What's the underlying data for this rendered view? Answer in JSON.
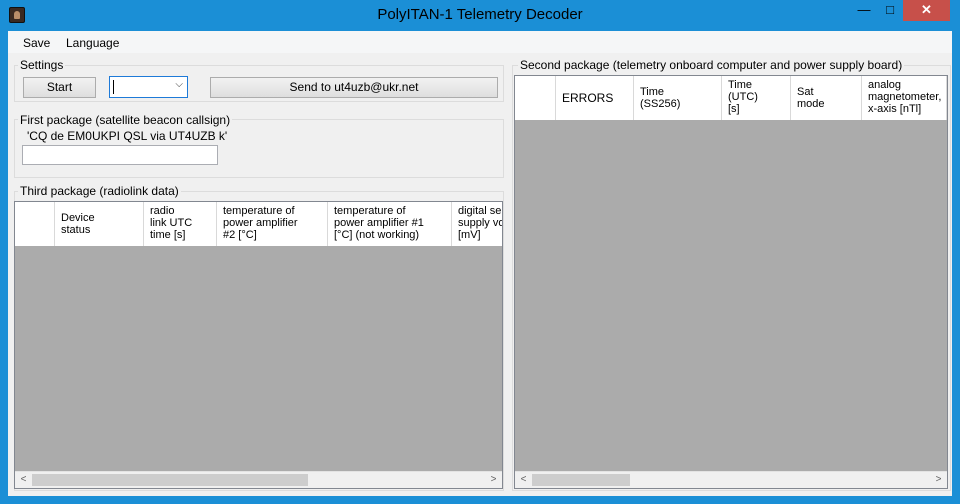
{
  "window": {
    "title": "PolyITAN-1 Telemetry Decoder",
    "min_glyph": "—",
    "max_glyph": "□",
    "close_glyph": "✕"
  },
  "menu": {
    "save": "Save",
    "language": "Language"
  },
  "settings": {
    "label": "Settings",
    "start": "Start",
    "combo_value": "",
    "send": "Send to ut4uzb@ukr.net"
  },
  "first_package": {
    "label": "First package (satellite beacon callsign)",
    "text": "'CQ de EM0UKPI QSL via UT4UZB k'",
    "input_value": ""
  },
  "third_package": {
    "label": "Third package (radiolink data)",
    "columns": [
      "Device\nstatus",
      "radio\nlink UTC\ntime [s]",
      "temperature of\npower amplifier\n#2 [°C]",
      "temperature of\npower amplifier #1\n[°C] (not working)",
      "digital se\nsupply vo\n[mV]"
    ]
  },
  "second_package": {
    "label": "Second package (telemetry onboard computer and power supply board)",
    "columns": [
      "ERRORS",
      "Time\n(SS256)",
      "Time\n(UTC)\n[s]",
      "Sat\nmode",
      "analog\nmagnetometer,\nx-axis [nTl]"
    ]
  },
  "scroll": {
    "left": "<",
    "right": ">"
  }
}
